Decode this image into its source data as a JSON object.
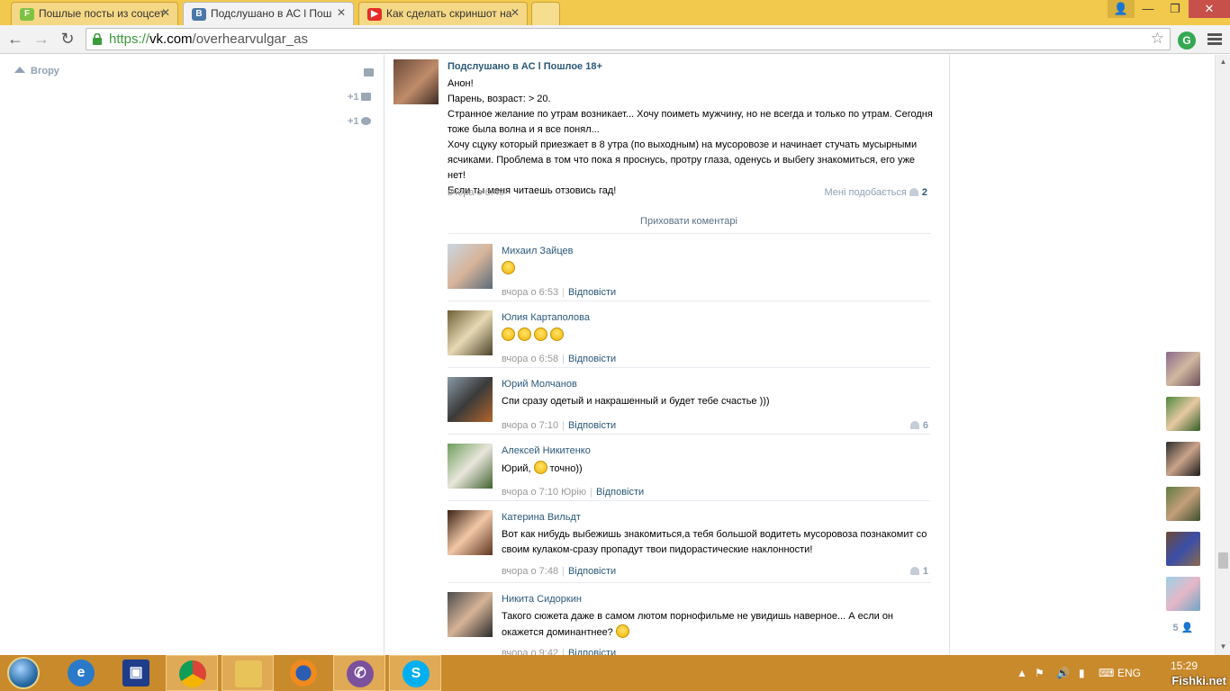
{
  "browser": {
    "tabs": [
      {
        "title": "Пошлые посты из соцсет",
        "favicon": "F",
        "active": false
      },
      {
        "title": "Подслушано в АС l Пош",
        "favicon": "B",
        "active": true
      },
      {
        "title": "Как сделать скриншот на",
        "favicon": "▶",
        "active": false
      }
    ],
    "url_scheme": "https://",
    "url_host": "vk.com",
    "url_path": "/overhearvulgar_as"
  },
  "sidebar": {
    "up_label": "Вгору",
    "messages_count": "+1",
    "settings_count": "+1"
  },
  "post": {
    "author": "Подслушано в АС l Пошлое 18+",
    "lines": [
      "Анон!",
      "Парень, возраст: > 20.",
      "Странное желание по утрам возникает... Хочу поиметь мужчину, но не всегда и только по утрам. Сегодня тоже была волна и я все понял...",
      "Хочу сцуку который приезжает в 8 утра (по выходным) на мусоровозе и начинает стучать мусырными ясчиками. Проблема в том что пока я проснусь, протру глаза, оденусь и выбегу знакомиться, его уже нет!",
      "Если ты меня читаешь отзовись гад!"
    ],
    "time": "вчора о 6:49",
    "like_label": "Мені подобається",
    "like_count": "2",
    "hide_comments": "Приховати коментарі"
  },
  "comments": [
    {
      "name": "Михаил Зайцев",
      "text": "",
      "emoji": 1,
      "time": "вчора о 6:53",
      "addressee": "",
      "reply": "Відповісти",
      "likes": ""
    },
    {
      "name": "Юлия Картаполова",
      "text": "",
      "emoji": 4,
      "time": "вчора о 6:58",
      "addressee": "",
      "reply": "Відповісти",
      "likes": ""
    },
    {
      "name": "Юрий Молчанов",
      "text": "Спи сразу одетый и накрашенный и будет тебе счастье )))",
      "emoji": 0,
      "time": "вчора о 7:10",
      "addressee": "",
      "reply": "Відповісти",
      "likes": "6"
    },
    {
      "name": "Алексей Никитенко",
      "text_before": "Юрий,",
      "text": "точно))",
      "emoji": 1,
      "time": "вчора о 7:10",
      "addressee": "Юрію",
      "reply": "Відповісти",
      "likes": ""
    },
    {
      "name": "Катерина Вильдт",
      "text": "Вот как нибудь выбежишь знакомиться,а тебя большой водитеть мусоровоза познакомит со своим кулаком-сразу пропадут твои пидорастические наклонности!",
      "emoji": 0,
      "time": "вчора о 7:48",
      "addressee": "",
      "reply": "Відповісти",
      "likes": "1"
    },
    {
      "name": "Никита Сидоркин",
      "text": "Такого сюжета даже в самом лютом порнофильме не увидишь наверное... А если он окажется доминантнее?",
      "emoji": 1,
      "time": "вчора о 9:42",
      "addressee": "",
      "reply": "Відповісти",
      "likes": ""
    }
  ],
  "friends_online_count": "5",
  "taskbar": {
    "apps": [
      "ie",
      "save",
      "chrome",
      "explorer",
      "firefox",
      "viber",
      "skype"
    ],
    "lang": "ENG",
    "time": "15:29",
    "watermark": "Fishki.net"
  }
}
